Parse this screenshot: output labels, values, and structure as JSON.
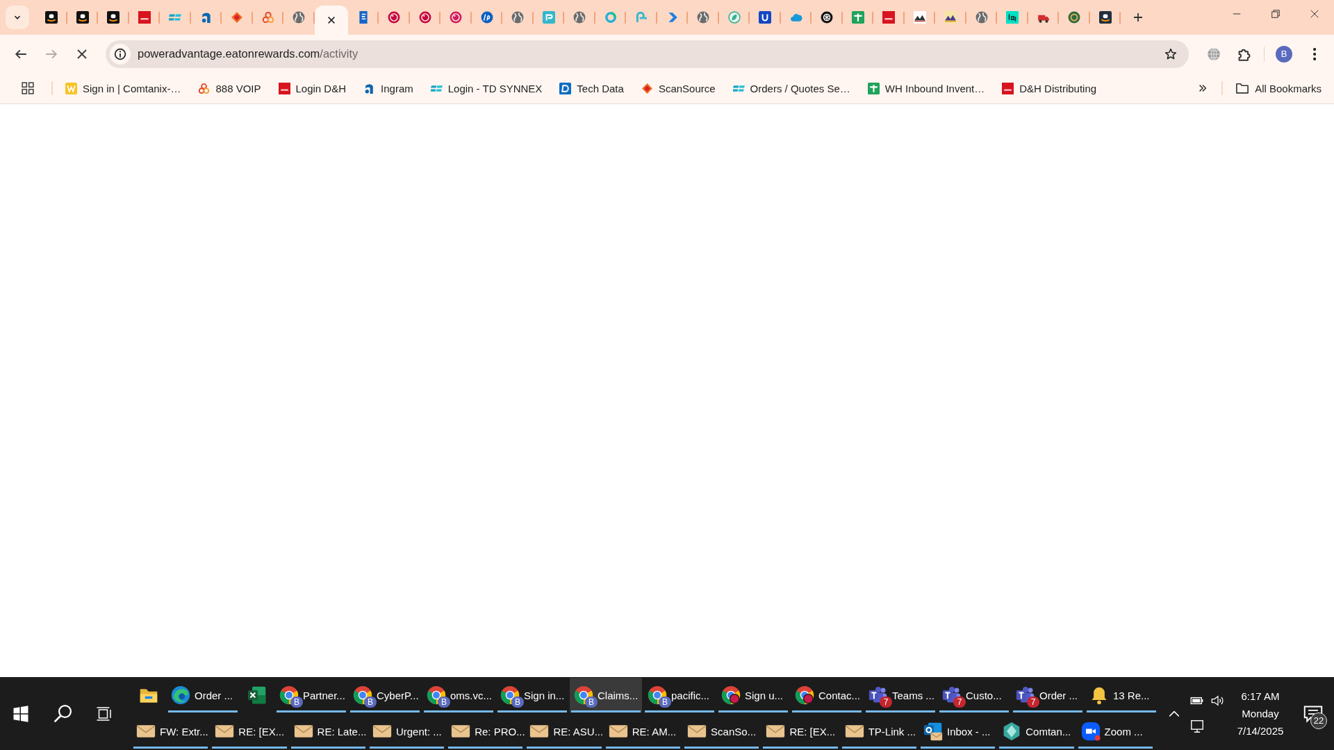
{
  "tabs": [
    {
      "kind": "amazon",
      "selected": false
    },
    {
      "kind": "amazon",
      "selected": false
    },
    {
      "kind": "amazon",
      "selected": false
    },
    {
      "kind": "dh",
      "selected": false
    },
    {
      "kind": "ec",
      "selected": false
    },
    {
      "kind": "ingram",
      "selected": false
    },
    {
      "kind": "scansource",
      "selected": false
    },
    {
      "kind": "voip",
      "selected": false
    },
    {
      "kind": "globe",
      "selected": false
    },
    {
      "kind": "none",
      "selected": true
    },
    {
      "kind": "doc",
      "selected": false
    },
    {
      "kind": "lg",
      "selected": false
    },
    {
      "kind": "lg",
      "selected": false
    },
    {
      "kind": "lgpink",
      "selected": false
    },
    {
      "kind": "hp",
      "selected": false
    },
    {
      "kind": "globe",
      "selected": false
    },
    {
      "kind": "tplink",
      "selected": false
    },
    {
      "kind": "globe",
      "selected": false
    },
    {
      "kind": "ring",
      "selected": false
    },
    {
      "kind": "hook",
      "selected": false
    },
    {
      "kind": "chevron",
      "selected": false
    },
    {
      "kind": "globe",
      "selected": false
    },
    {
      "kind": "leaf",
      "selected": false
    },
    {
      "kind": "u",
      "selected": false
    },
    {
      "kind": "cloud",
      "selected": false
    },
    {
      "kind": "knot",
      "selected": false
    },
    {
      "kind": "sheet",
      "selected": false
    },
    {
      "kind": "dh",
      "selected": false
    },
    {
      "kind": "mountains",
      "selected": false
    },
    {
      "kind": "mountainsy",
      "selected": false
    },
    {
      "kind": "globe",
      "selected": false
    },
    {
      "kind": "logi",
      "selected": false
    },
    {
      "kind": "truck",
      "selected": false
    },
    {
      "kind": "emblem",
      "selected": false
    },
    {
      "kind": "amazondark",
      "selected": false
    }
  ],
  "toolbar": {
    "back_disabled": false,
    "forward_disabled": true,
    "loading": true,
    "url_host": "poweradvantage.eatonrewards.com",
    "url_path": "/activity",
    "avatar": "B"
  },
  "bookmarks": {
    "items": [
      {
        "kind": "w",
        "label": "Sign in | Comtanix-…"
      },
      {
        "kind": "voip",
        "label": "888 VOIP"
      },
      {
        "kind": "dh",
        "label": "Login D&H"
      },
      {
        "kind": "ingram",
        "label": "Ingram"
      },
      {
        "kind": "ec",
        "label": "Login - TD SYNNEX"
      },
      {
        "kind": "techdata",
        "label": "Tech Data"
      },
      {
        "kind": "scansource",
        "label": "ScanSource"
      },
      {
        "kind": "ec",
        "label": "Orders / Quotes Se…"
      },
      {
        "kind": "sheet",
        "label": "WH Inbound Invent…"
      },
      {
        "kind": "dh",
        "label": "D&H Distributing"
      }
    ],
    "all_bookmarks": "All Bookmarks"
  },
  "taskbar": {
    "top_row": [
      {
        "kind": "explorer",
        "running": false,
        "selected": false
      },
      {
        "kind": "edge",
        "label": "Order ...",
        "running": true,
        "selected": false
      },
      {
        "kind": "excel",
        "running": false,
        "selected": false
      },
      {
        "kind": "chrome",
        "label": "Partner...",
        "badge": "B",
        "running": true,
        "selected": false
      },
      {
        "kind": "chrome",
        "label": "CyberP...",
        "badge": "B",
        "running": true,
        "selected": false
      },
      {
        "kind": "chrome",
        "label": "oms.vc...",
        "badge": "B",
        "running": true,
        "selected": false
      },
      {
        "kind": "chrome",
        "label": "Sign in...",
        "badge": "B",
        "running": true,
        "selected": false
      },
      {
        "kind": "chrome",
        "label": "Claims...",
        "badge": "B",
        "running": true,
        "selected": true
      },
      {
        "kind": "chrome",
        "label": "pacific...",
        "badge": "B",
        "running": true,
        "selected": false
      },
      {
        "kind": "chromered",
        "label": "Sign u...",
        "running": true,
        "selected": false
      },
      {
        "kind": "chromered",
        "label": "Contac...",
        "running": true,
        "selected": false
      },
      {
        "kind": "teams",
        "label": "Teams ...",
        "badge": "7",
        "running": true,
        "selected": false
      },
      {
        "kind": "teams",
        "label": "Custo...",
        "badge": "7",
        "running": true,
        "selected": false
      },
      {
        "kind": "teams",
        "label": "Order ...",
        "badge": "7",
        "running": true,
        "selected": false
      },
      {
        "kind": "bell",
        "label": "13 Re...",
        "running": true,
        "selected": false
      }
    ],
    "bottom_row": [
      {
        "kind": "mail",
        "label": "FW: Extr...",
        "running": true,
        "selected": false
      },
      {
        "kind": "mail",
        "label": "RE: [EX...",
        "running": true,
        "selected": false
      },
      {
        "kind": "mail",
        "label": "RE: Late...",
        "running": true,
        "selected": false
      },
      {
        "kind": "mail",
        "label": "Urgent: ...",
        "running": true,
        "selected": false
      },
      {
        "kind": "mail",
        "label": "Re: PRO...",
        "running": true,
        "selected": false
      },
      {
        "kind": "mail",
        "label": "RE: ASU...",
        "running": true,
        "selected": false
      },
      {
        "kind": "mail",
        "label": "RE: AM...",
        "running": true,
        "selected": false
      },
      {
        "kind": "mail",
        "label": "ScanSo...",
        "running": true,
        "selected": false
      },
      {
        "kind": "mail",
        "label": "RE: [EX...",
        "running": true,
        "selected": false
      },
      {
        "kind": "mail",
        "label": "TP-Link ...",
        "running": true,
        "selected": false
      },
      {
        "kind": "outlook",
        "label": "Inbox - ...",
        "running": true,
        "selected": false
      },
      {
        "kind": "hexagon",
        "label": "Comtan...",
        "running": true,
        "selected": false
      },
      {
        "kind": "zoom",
        "label": "Zoom ...",
        "running": true,
        "selected": false
      }
    ],
    "clock": {
      "time": "6:17 AM",
      "day": "Monday",
      "date": "7/14/2025"
    },
    "notifications": "22"
  }
}
